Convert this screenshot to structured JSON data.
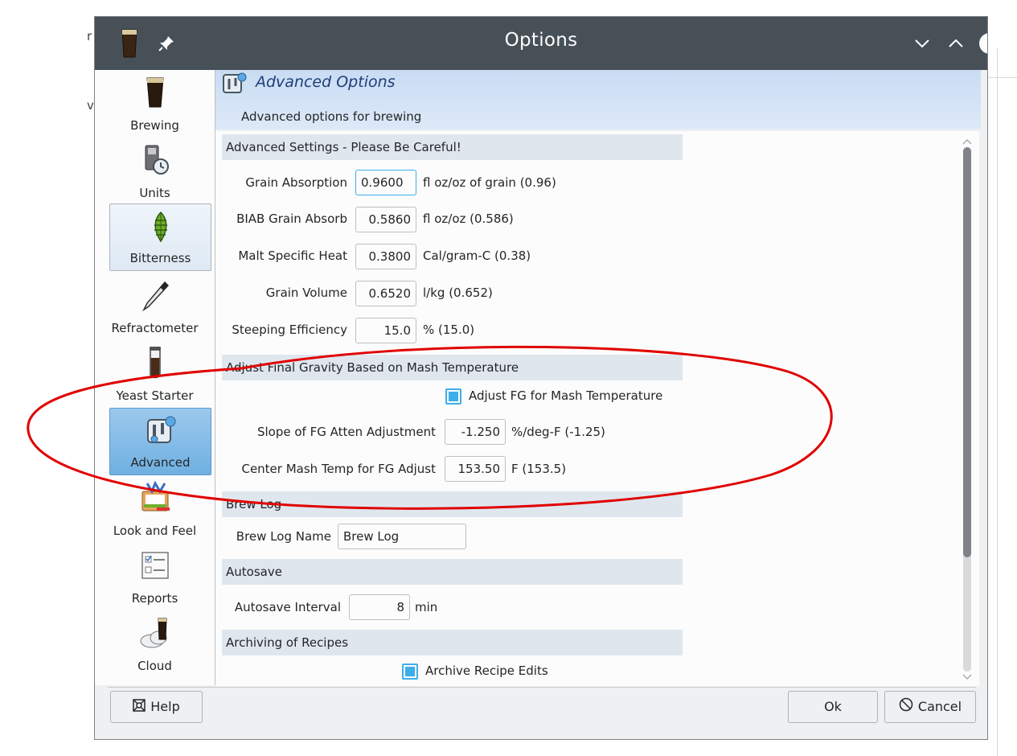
{
  "window": {
    "title": "Options"
  },
  "sidebar": {
    "items": [
      {
        "label": "Brewing",
        "icon": "beer-glass-icon"
      },
      {
        "label": "Units",
        "icon": "units-icon"
      },
      {
        "label": "Bitterness",
        "icon": "hops-icon"
      },
      {
        "label": "Refractometer",
        "icon": "refractometer-icon"
      },
      {
        "label": "Yeast Starter",
        "icon": "test-tube-icon"
      },
      {
        "label": "Advanced",
        "icon": "advanced-icon"
      },
      {
        "label": "Look and Feel",
        "icon": "palette-icon"
      },
      {
        "label": "Reports",
        "icon": "checklist-icon"
      },
      {
        "label": "Cloud",
        "icon": "cloud-beer-icon"
      }
    ]
  },
  "header": {
    "title": "Advanced Options",
    "subtitle": "Advanced options for brewing"
  },
  "sections": {
    "advanced": {
      "title": "Advanced Settings - Please Be Careful!",
      "fields": [
        {
          "label": "Grain Absorption",
          "value": "0.9600",
          "suffix": "fl oz/oz of grain (0.96)"
        },
        {
          "label": "BIAB Grain Absorb",
          "value": "0.5860",
          "suffix": "fl oz/oz (0.586)"
        },
        {
          "label": "Malt Specific Heat",
          "value": "0.3800",
          "suffix": "Cal/gram-C (0.38)"
        },
        {
          "label": "Grain Volume",
          "value": "0.6520",
          "suffix": "l/kg (0.652)"
        },
        {
          "label": "Steeping Efficiency",
          "value": "15.0",
          "suffix": "% (15.0)"
        }
      ]
    },
    "fg": {
      "title": "Adjust Final Gravity Based on Mash Temperature",
      "checkbox_label": "Adjust FG for Mash Temperature",
      "fields": [
        {
          "label": "Slope of FG Atten Adjustment",
          "value": "-1.250",
          "suffix": "%/deg-F (-1.25)"
        },
        {
          "label": "Center Mash Temp for FG Adjust",
          "value": "153.50",
          "suffix": "F (153.5)"
        }
      ]
    },
    "brewlog": {
      "title": "Brew Log",
      "label": "Brew Log Name",
      "value": "Brew Log"
    },
    "autosave": {
      "title": "Autosave",
      "label": "Autosave Interval",
      "value": "8",
      "suffix": "min"
    },
    "archiving": {
      "title": "Archiving of Recipes",
      "checkbox_label": "Archive Recipe Edits"
    }
  },
  "footer": {
    "help": "Help",
    "ok": "Ok",
    "cancel": "Cancel"
  },
  "background": {
    "frag1": "r",
    "frag2": "v"
  },
  "colors": {
    "accent": "#3daee9",
    "titlebar": "#475057",
    "annotation": "#e00000"
  }
}
